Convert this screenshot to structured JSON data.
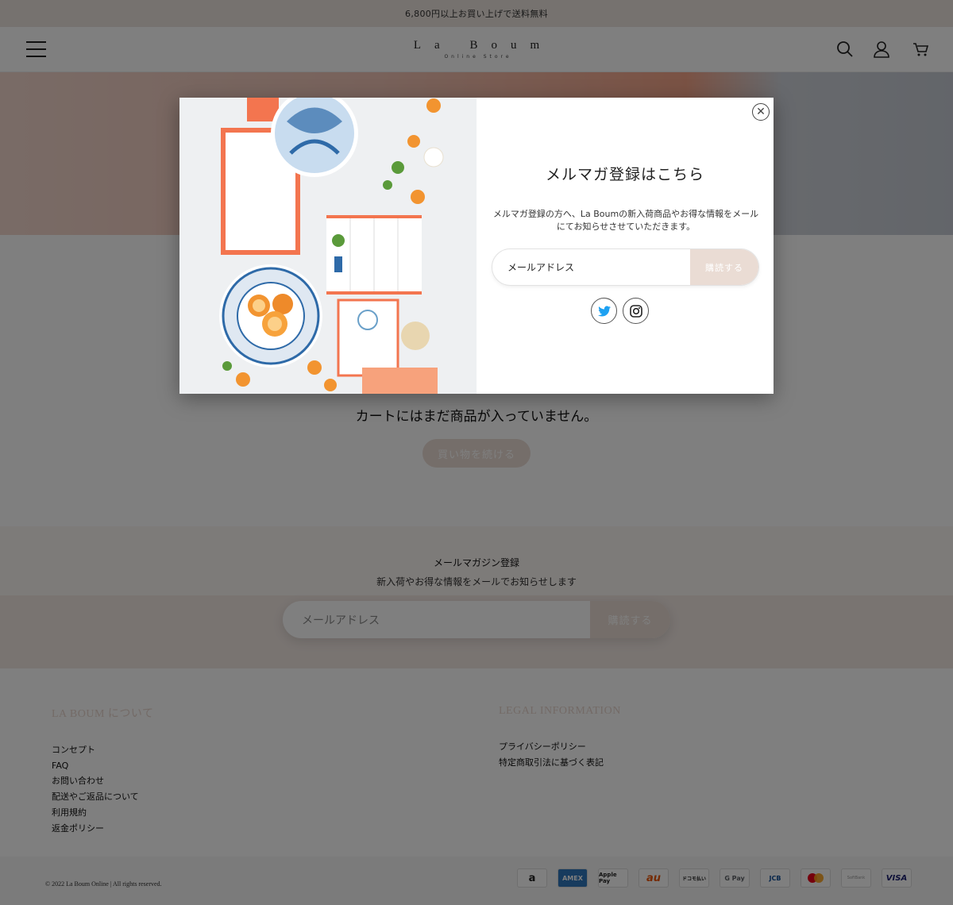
{
  "announcement": "6,800円以上お買い上げで送料無料",
  "header": {
    "logo_main": "La Boum",
    "logo_sub": "Online Store"
  },
  "cart": {
    "empty_message": "カートにはまだ商品が入っていません。",
    "continue_label": "買い物を続ける"
  },
  "newsletter": {
    "title": "メールマガジン登録",
    "description": "新入荷やお得な情報をメールでお知らせします",
    "email_placeholder": "メールアドレス",
    "subscribe_label": "購読する"
  },
  "footer": {
    "col1_heading": "LA BOUM について",
    "col1_links": [
      "コンセプト",
      "FAQ",
      "お問い合わせ",
      "配送やご返品について",
      "利用規約",
      "返金ポリシー"
    ],
    "col2_heading": "LEGAL INFORMATION",
    "col2_links": [
      "プライバシーポリシー",
      "特定商取引法に基づく表記"
    ],
    "copyright": "© 2022 La Boum Online | All rights reserved.",
    "payments": [
      "a",
      "AMEX",
      "Apple Pay",
      "au",
      "ドコモ払い",
      "G Pay",
      "JCB",
      "Mastercard",
      "SoftBank",
      "VISA"
    ]
  },
  "modal": {
    "title": "メルマガ登録はこちら",
    "description": "メルマガ登録の方へ、La Boumの新入荷商品やお得な情報をメールにてお知らせさせていただきます。",
    "email_placeholder": "メールアドレス",
    "subscribe_label": "購読する",
    "social": [
      "twitter-icon",
      "instagram-icon"
    ]
  },
  "colors": {
    "accent": "#eadcd4",
    "footer_heading": "#e7d5cd",
    "twitter": "#1da1f2"
  }
}
